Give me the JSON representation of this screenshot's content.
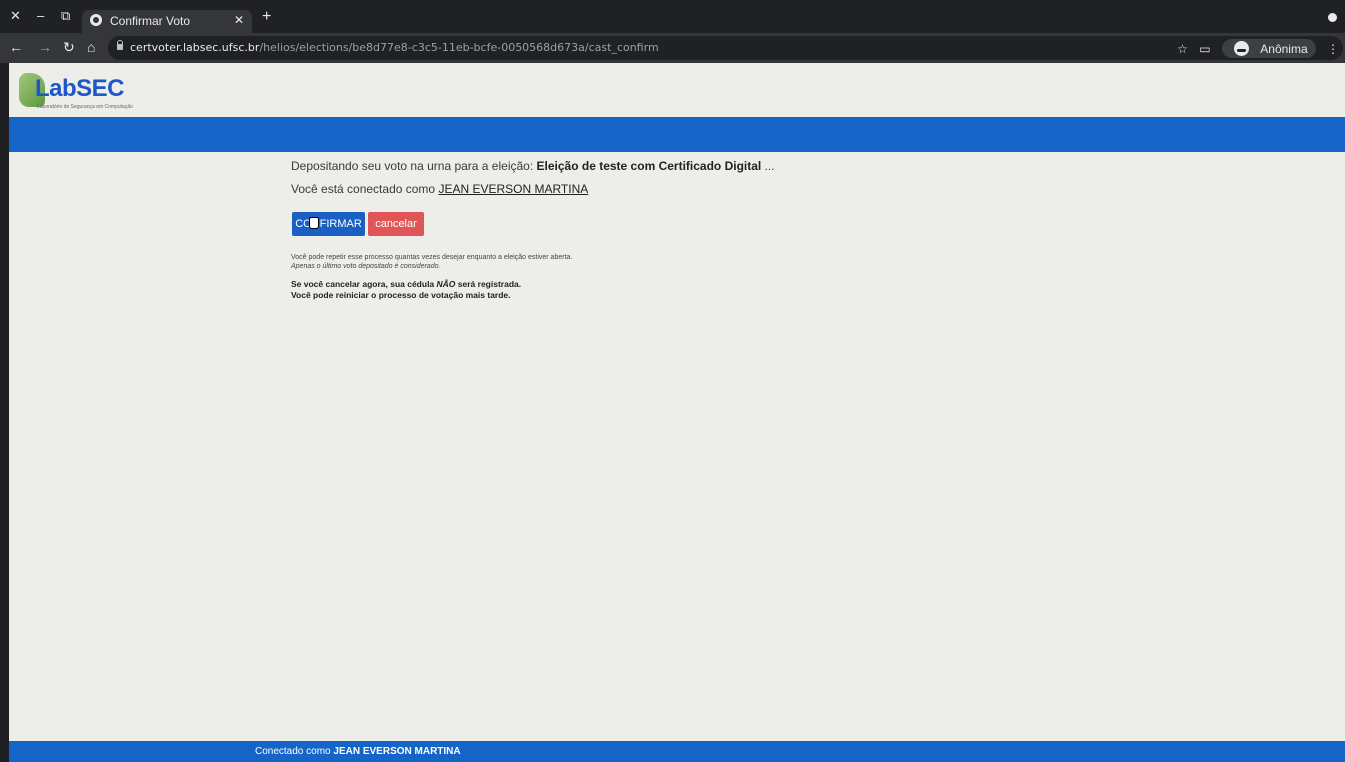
{
  "browser": {
    "tab_title": "Confirmar Voto",
    "url_host": "certvoter.labsec.ufsc.br",
    "url_path": "/helios/elections/be8d77e8-c3c5-11eb-bcfe-0050568d673a/cast_confirm",
    "profile_label": "Anônima"
  },
  "logo": {
    "text": "LabSEC",
    "subtitle": "Laboratório de Segurança em Computação"
  },
  "main": {
    "intro_text": "Depositando seu voto na urna para a eleição: ",
    "election_name": "Eleição de teste com Certificado Digital",
    "ellipsis": " ...",
    "connected_text": "Você está conectado como ",
    "user_name": "JEAN EVERSON MARTINA",
    "confirm_label": "CONFIRMAR",
    "cancel_label": "cancelar",
    "repeat_note": "Você pode repetir esse processo quantas vezes desejar enquanto a eleição estiver aberta.",
    "last_vote_note": "Apenas o último voto depositado é considerado.",
    "warning_part1": "Se você cancelar agora, sua cédula ",
    "warning_nao": "NÃO",
    "warning_part2": " será registrada.",
    "restart_note": "Você pode reiniciar o processo de votação mais tarde."
  },
  "footer": {
    "connected_label": "Conectado como ",
    "user_name": "JEAN EVERSON MARTINA"
  },
  "colors": {
    "brand_blue": "#1565c8",
    "cancel_red": "#e05656"
  }
}
